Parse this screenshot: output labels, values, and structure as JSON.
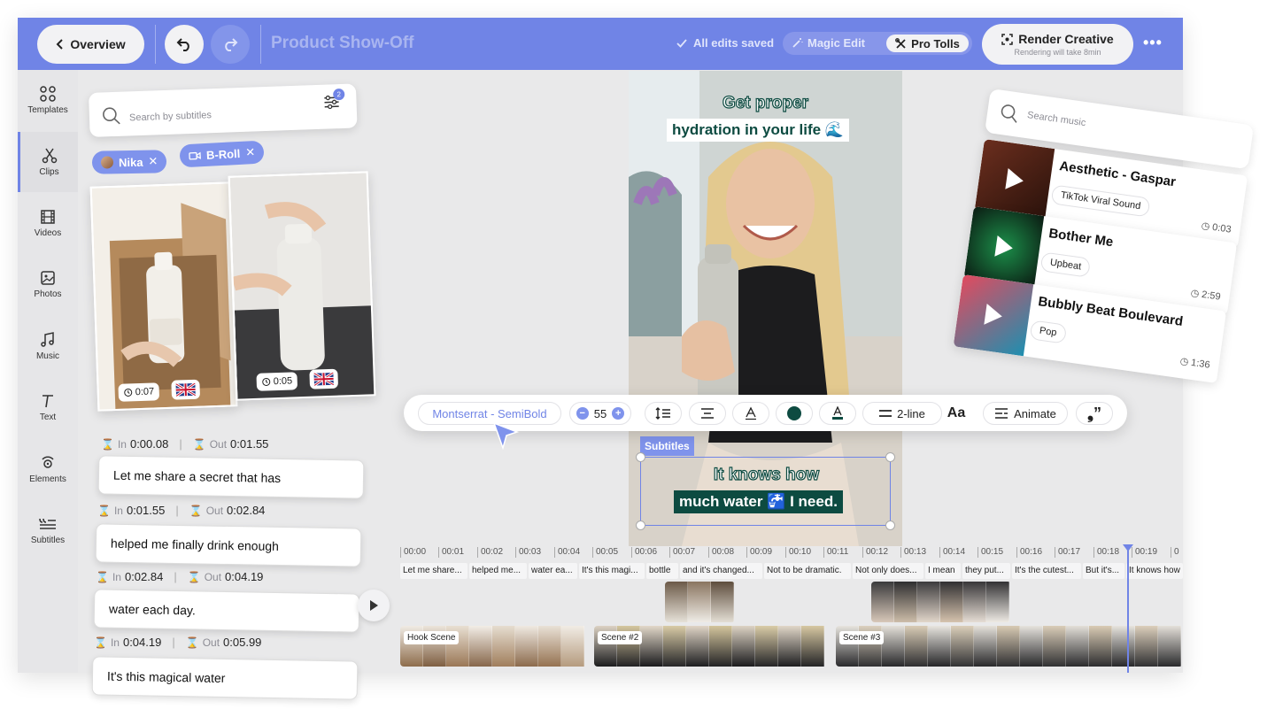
{
  "header": {
    "back_label": "Overview",
    "project_title": "Product Show-Off",
    "saved_status": "All edits saved",
    "mode_magic": "Magic Edit",
    "mode_pro": "Pro Tolls",
    "render_label": "Render Creative",
    "render_sub": "Rendering will take 8min",
    "more": "•••"
  },
  "sidebar": {
    "items": [
      {
        "label": "Templates",
        "icon": "grid-icon"
      },
      {
        "label": "Clips",
        "icon": "scissors-icon"
      },
      {
        "label": "Videos",
        "icon": "film-icon"
      },
      {
        "label": "Photos",
        "icon": "image-icon"
      },
      {
        "label": "Music",
        "icon": "music-icon"
      },
      {
        "label": "Text",
        "icon": "text-icon"
      },
      {
        "label": "Elements",
        "icon": "elements-icon"
      },
      {
        "label": "Subtitles",
        "icon": "subtitles-icon"
      }
    ]
  },
  "clips": {
    "search_placeholder": "Search by subtitles",
    "filter_count": "2",
    "chips": [
      "Nika",
      "B-Roll"
    ],
    "cards": [
      {
        "duration": "0:07"
      },
      {
        "duration": "0:05"
      }
    ]
  },
  "subtitles": {
    "in_label": "In",
    "out_label": "Out",
    "items": [
      {
        "in": "0:00.08",
        "out": "0:01.55",
        "text": "Let me share a secret that has"
      },
      {
        "in": "0:01.55",
        "out": "0:02.84",
        "text": "helped me finally drink enough"
      },
      {
        "in": "0:02.84",
        "out": "0:04.19",
        "text": "water each day."
      },
      {
        "in": "0:04.19",
        "out": "0:05.99",
        "text": "It's this magical water"
      }
    ]
  },
  "preview": {
    "caption_top_line1": "Get proper",
    "caption_top_line2": "hydration in your life 🌊",
    "caption_bottom_line1": "It knows how",
    "caption_bottom_line2": "much water 🚰 I need.",
    "subtitles_tag": "Subtitles"
  },
  "format_toolbar": {
    "font": "Montserrat - SemiBold",
    "size": "55",
    "lines": "2-line",
    "animate": "Animate",
    "text_color": "#0d4b41"
  },
  "music": {
    "search_placeholder": "Search music",
    "tracks": [
      {
        "title": "Aesthetic - Gaspar",
        "tag": "TikTok Viral Sound",
        "duration": "0:03"
      },
      {
        "title": "Bother Me",
        "tag": "Upbeat",
        "duration": "2:59"
      },
      {
        "title": "Bubbly Beat Boulevard",
        "tag": "Pop",
        "duration": "1:36"
      }
    ]
  },
  "timeline": {
    "ticks": [
      "00:00",
      "00:01",
      "00:02",
      "00:03",
      "00:04",
      "00:05",
      "00:06",
      "00:07",
      "00:08",
      "00:09",
      "00:10",
      "00:11",
      "00:12",
      "00:13",
      "00:14",
      "00:15",
      "00:16",
      "00:17",
      "00:18",
      "00:19",
      "0"
    ],
    "subtitle_segments": [
      "Let me share...",
      "helped me...",
      "water ea...",
      "It's this magi...",
      "bottle",
      "and it's changed...",
      "Not to be dramatic.",
      "Not only does...",
      "I mean",
      "they put...",
      "It's the cutest...",
      "But it's...",
      "It knows how"
    ],
    "scenes": [
      "Hook Scene",
      "Scene #2",
      "Scene #3"
    ]
  },
  "colors": {
    "accent": "#7084e6",
    "caption_green": "#0d4b41"
  }
}
